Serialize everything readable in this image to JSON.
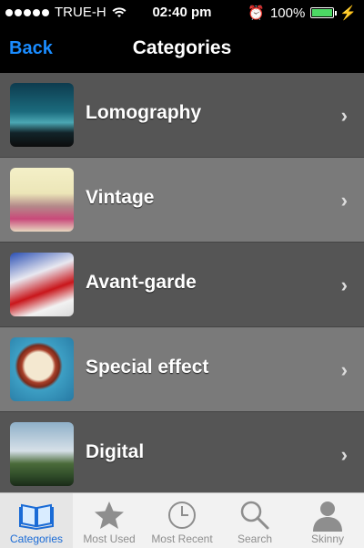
{
  "status": {
    "carrier": "TRUE-H",
    "time": "02:40 pm",
    "battery": "100%"
  },
  "nav": {
    "back": "Back",
    "title": "Categories"
  },
  "categories": [
    {
      "label": "Lomography",
      "icon": "lomography-thumb"
    },
    {
      "label": "Vintage",
      "icon": "vintage-thumb"
    },
    {
      "label": "Avant-garde",
      "icon": "avant-garde-thumb"
    },
    {
      "label": "Special effect",
      "icon": "special-effect-thumb"
    },
    {
      "label": "Digital",
      "icon": "digital-thumb"
    }
  ],
  "tabs": [
    {
      "label": "Categories",
      "active": true
    },
    {
      "label": "Most Used"
    },
    {
      "label": "Most Recent"
    },
    {
      "label": "Search"
    },
    {
      "label": "Skinny"
    }
  ],
  "colors": {
    "accent": "#1a8cff",
    "battery": "#4cd964"
  }
}
